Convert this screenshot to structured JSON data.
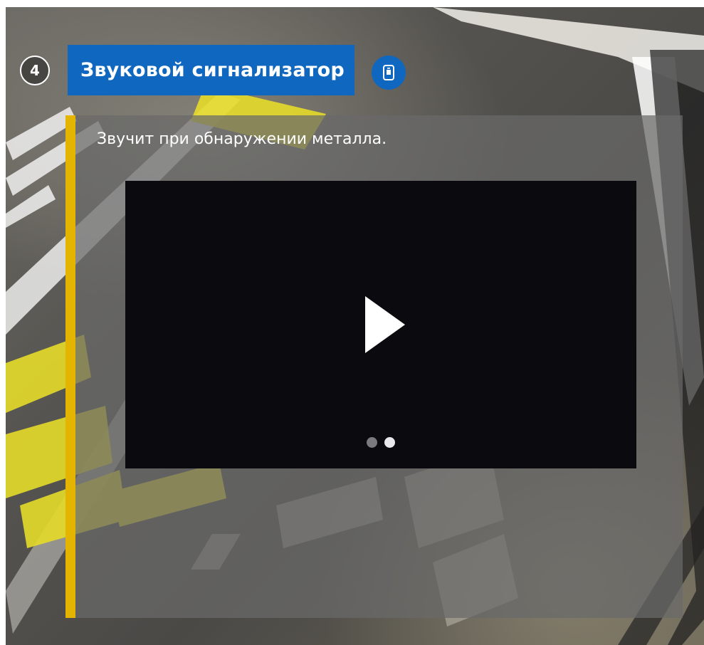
{
  "step": {
    "number": "4"
  },
  "header": {
    "title": "Звуковой сигнализатор",
    "info_icon": "device-icon"
  },
  "panel": {
    "description": "Звучит при обнаружении металла."
  },
  "video": {
    "play_icon": "play-icon",
    "carousel": {
      "count": 2,
      "active_index": 1
    }
  },
  "colors": {
    "accent_blue": "#1067bf",
    "accent_yellow": "#e3b400",
    "panel_overlay": "#696969",
    "video_bg": "#0b0a0f"
  }
}
